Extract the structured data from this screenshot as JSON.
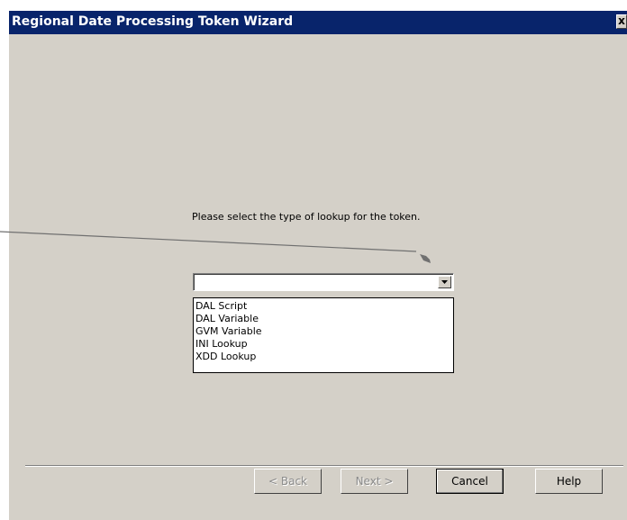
{
  "window": {
    "title": "Regional Date Processing Token Wizard",
    "close_glyph": "x"
  },
  "main": {
    "prompt": "Please select the type of lookup for the token.",
    "combo_value": "",
    "options": [
      "DAL Script",
      "DAL Variable",
      "GVM Variable",
      "INI Lookup",
      "XDD Lookup"
    ]
  },
  "buttons": {
    "back": "< Back",
    "next": "Next >",
    "cancel": "Cancel",
    "help": "Help"
  },
  "colors": {
    "titlebar": "#08246b",
    "dialog_bg": "#d4d0c8"
  },
  "icons": {
    "close": "close-icon",
    "dropdown": "chevron-down-icon",
    "annotation": "arrow-annotation"
  }
}
